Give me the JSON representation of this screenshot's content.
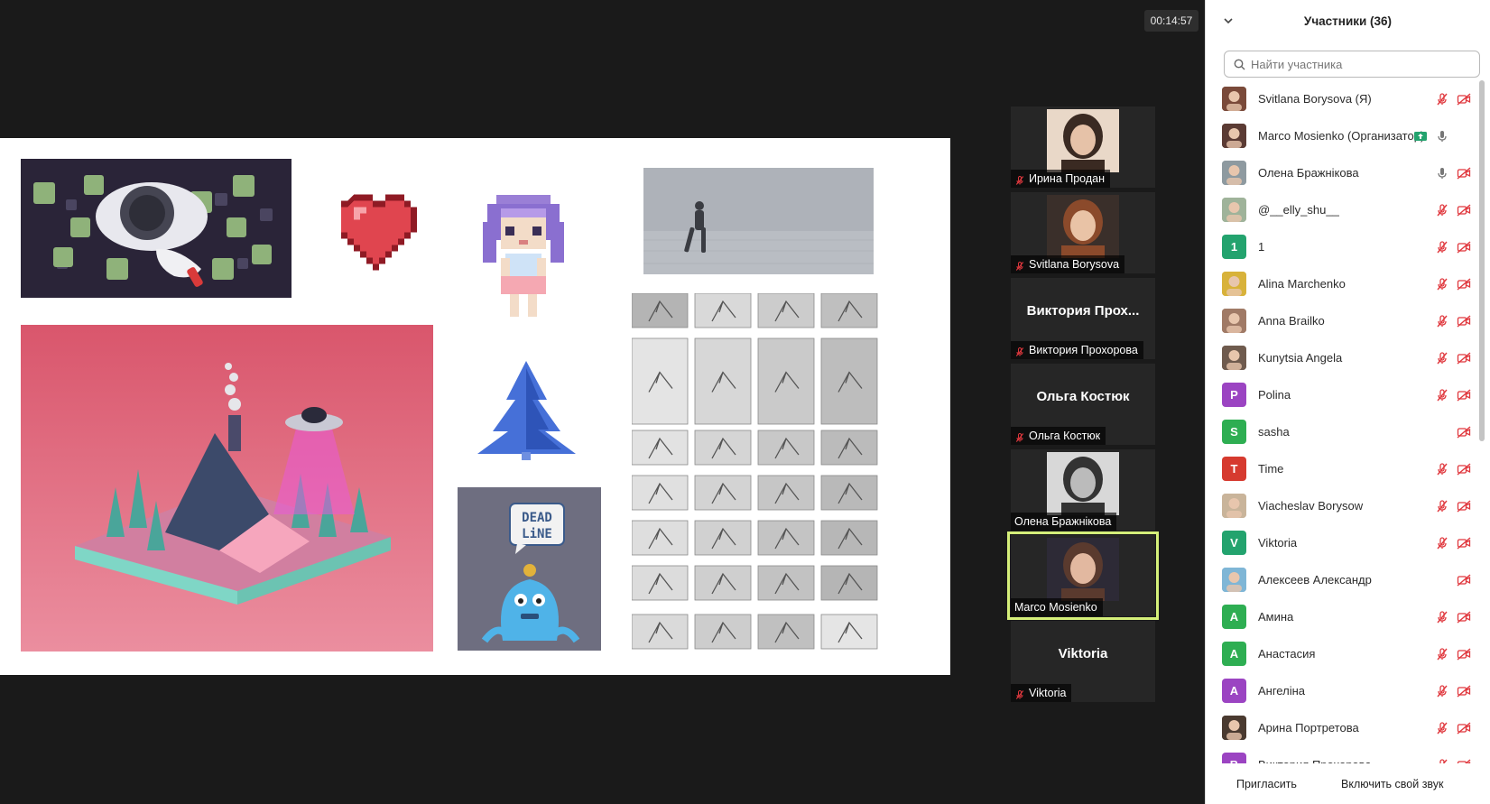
{
  "meeting": {
    "timer": "00:14:57"
  },
  "gallery": [
    {
      "name": "Ирина Продан",
      "big": "",
      "mic_off": true,
      "photo": "woman-dark-hair",
      "active": false
    },
    {
      "name": "Svitlana Borysova",
      "big": "",
      "mic_off": true,
      "photo": "woman-auburn",
      "active": false
    },
    {
      "name": "Виктория Прохорова",
      "big": "Виктория  Прох...",
      "mic_off": true,
      "photo": "",
      "active": false
    },
    {
      "name": "Ольга Костюк",
      "big": "Ольга Костюк",
      "mic_off": true,
      "photo": "",
      "active": false
    },
    {
      "name": "Олена Бражнікова",
      "big": "",
      "mic_off": false,
      "photo": "bw-dancers",
      "active": false
    },
    {
      "name": "Marco Mosienko",
      "big": "",
      "mic_off": false,
      "photo": "man-headphones",
      "active": true
    },
    {
      "name": "Viktoria",
      "big": "Viktoria",
      "mic_off": true,
      "photo": "",
      "active": false
    }
  ],
  "panel": {
    "title": "Участники (36)",
    "search_placeholder": "Найти участника",
    "invite_label": "Пригласить",
    "unmute_label": "Включить свой звук"
  },
  "participants": [
    {
      "name": "Svitlana Borysova (Я)",
      "avatar": "photo",
      "color": "#7a4a3a",
      "letter": "",
      "mic": "off",
      "video": "off",
      "share": false
    },
    {
      "name": "Marco Mosienko (Организатор)",
      "avatar": "photo",
      "color": "#5b3b34",
      "letter": "",
      "mic": "on",
      "video": "none",
      "share": true
    },
    {
      "name": "Олена Бражнікова",
      "avatar": "photo",
      "color": "#8e9aa0",
      "letter": "",
      "mic": "on",
      "video": "off",
      "share": false
    },
    {
      "name": "@__elly_shu__",
      "avatar": "photo",
      "color": "#9fb39a",
      "letter": "",
      "mic": "off",
      "video": "off",
      "share": false
    },
    {
      "name": "1",
      "avatar": "letter",
      "color": "#23a36e",
      "letter": "1",
      "mic": "off",
      "video": "off",
      "share": false
    },
    {
      "name": "Alina Marchenko",
      "avatar": "photo",
      "color": "#d8b23a",
      "letter": "",
      "mic": "off",
      "video": "off",
      "share": false
    },
    {
      "name": "Anna Brailko",
      "avatar": "photo",
      "color": "#a07a66",
      "letter": "",
      "mic": "off",
      "video": "off",
      "share": false
    },
    {
      "name": "Kunytsia Angela",
      "avatar": "photo",
      "color": "#6f5b4e",
      "letter": "",
      "mic": "off",
      "video": "off",
      "share": false
    },
    {
      "name": "Polina",
      "avatar": "letter",
      "color": "#9b44c2",
      "letter": "P",
      "mic": "off",
      "video": "off",
      "share": false
    },
    {
      "name": "sasha",
      "avatar": "letter",
      "color": "#2eae52",
      "letter": "S",
      "mic": "none",
      "video": "off",
      "share": false
    },
    {
      "name": "Time",
      "avatar": "letter",
      "color": "#d63a2f",
      "letter": "T",
      "mic": "off",
      "video": "off",
      "share": false
    },
    {
      "name": "Viacheslav Borysow",
      "avatar": "photo",
      "color": "#c9b49a",
      "letter": "",
      "mic": "off",
      "video": "off",
      "share": false
    },
    {
      "name": "Viktoria",
      "avatar": "letter",
      "color": "#23a36e",
      "letter": "V",
      "mic": "off",
      "video": "off",
      "share": false
    },
    {
      "name": "Алексеев Александр",
      "avatar": "photo",
      "color": "#7fb6d6",
      "letter": "",
      "mic": "none",
      "video": "off",
      "share": false
    },
    {
      "name": "Амина",
      "avatar": "letter",
      "color": "#2eae52",
      "letter": "A",
      "mic": "off",
      "video": "off",
      "share": false
    },
    {
      "name": "Анастасия",
      "avatar": "letter",
      "color": "#2eae52",
      "letter": "A",
      "mic": "off",
      "video": "off",
      "share": false
    },
    {
      "name": "Ангеліна",
      "avatar": "letter",
      "color": "#9b44c2",
      "letter": "A",
      "mic": "off",
      "video": "off",
      "share": false
    },
    {
      "name": "Арина Портретова",
      "avatar": "photo",
      "color": "#4a3a30",
      "letter": "",
      "mic": "off",
      "video": "off",
      "share": false
    },
    {
      "name": "Виктория Прохорова",
      "avatar": "letter",
      "color": "#9b44c2",
      "letter": "B",
      "mic": "off",
      "video": "off",
      "share": false
    }
  ],
  "colors": {
    "active_speaker": "#d5ef7a",
    "muted_red": "#e0383e",
    "share_green": "#23a36e"
  },
  "art": {
    "deadline_text": [
      "DEAD",
      "LiNE"
    ]
  }
}
